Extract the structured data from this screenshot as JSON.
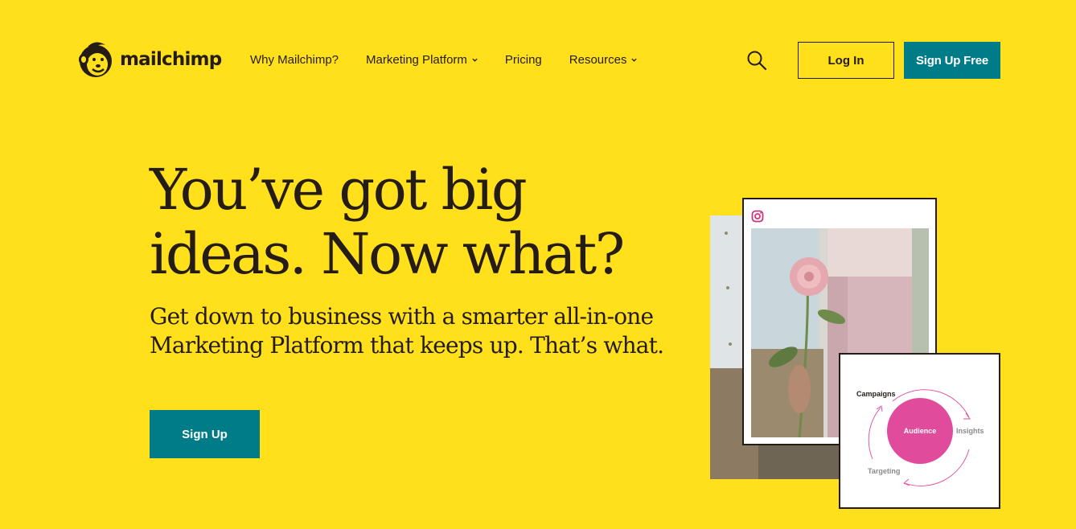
{
  "brand": {
    "name": "mailchimp",
    "accent": "#ffe01b",
    "button_color": "#007c89"
  },
  "nav": {
    "items": [
      {
        "label": "Why Mailchimp?",
        "has_dropdown": false
      },
      {
        "label": "Marketing Platform",
        "has_dropdown": true
      },
      {
        "label": "Pricing",
        "has_dropdown": false
      },
      {
        "label": "Resources",
        "has_dropdown": true
      }
    ],
    "search_icon": "search-icon",
    "login_label": "Log In",
    "signup_free_label": "Sign Up Free"
  },
  "hero": {
    "title": "You’ve got big ideas. Now what?",
    "subtitle": "Get down to business with a smarter all-in-one Marketing Platform that keeps up. That’s what.",
    "cta_label": "Sign Up"
  },
  "collage": {
    "social_icon": "instagram-icon",
    "diagram": {
      "center": "Audience",
      "labels": [
        "Campaigns",
        "Insights",
        "Targeting"
      ],
      "center_color": "#e14b9b"
    }
  }
}
